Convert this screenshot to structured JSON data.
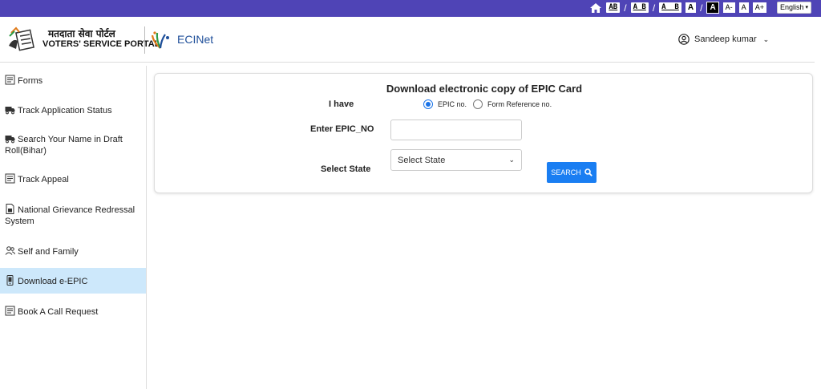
{
  "topbar": {
    "spacing_1": "AB",
    "spacing_2": "A_B",
    "spacing_3": "A__B",
    "contrast_light": "A",
    "contrast_dark": "A",
    "font_decrease": "A-",
    "font_normal": "A",
    "font_increase": "A+",
    "language": "English"
  },
  "header": {
    "portal_name_hindi": "मतदाता सेवा पोर्टल",
    "portal_name": "VOTERS' SERVICE PORTAL",
    "ecinet": "ECINet",
    "user_name": "Sandeep kumar"
  },
  "sidebar": {
    "items": [
      {
        "label": "Forms",
        "icon": "form-icon"
      },
      {
        "label": "Track Application Status",
        "icon": "truck-icon"
      },
      {
        "label": "Search Your Name in Draft Roll(Bihar)",
        "icon": "truck-icon"
      },
      {
        "label": "Track Appeal",
        "icon": "form-icon"
      },
      {
        "label": "National Grievance Redressal System",
        "icon": "document-icon"
      },
      {
        "label": "Self and Family",
        "icon": "users-icon"
      },
      {
        "label": "Download e-EPIC",
        "icon": "phone-icon",
        "active": true
      },
      {
        "label": "Book A Call Request",
        "icon": "form-icon"
      }
    ]
  },
  "main": {
    "title": "Download electronic copy of EPIC Card",
    "i_have_label": "I have",
    "option_epic": "EPIC no.",
    "option_form_ref": "Form Reference no.",
    "selected_option": "EPIC no.",
    "epic_label": "Enter EPIC_NO",
    "epic_value": "",
    "state_label": "Select State",
    "state_value": "Select State",
    "search_label": "SEARCH"
  },
  "colors": {
    "topbar": "#4f44b6",
    "accent": "#1a7ef2",
    "active_nav": "#cde8fb",
    "ecinet_text": "#1f4f9a"
  }
}
